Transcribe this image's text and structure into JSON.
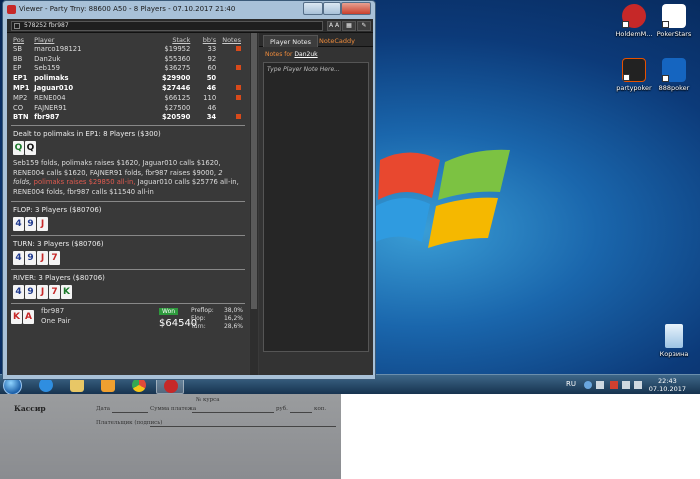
{
  "window": {
    "title": "Viewer - Party Trny: 88600 A50 - 8 Players - 07.10.2017 21:40",
    "hand_id": "578252 fbr987",
    "font_button": "A A"
  },
  "players": {
    "headers": {
      "pos": "Pos",
      "player": "Player",
      "stack": "Stack",
      "bbs": "bb's",
      "notes": "Notes"
    },
    "rows": [
      {
        "pos": "SB",
        "player": "marco198121",
        "stack": "$19952",
        "bbs": "33",
        "note": true,
        "hero": false
      },
      {
        "pos": "BB",
        "player": "Dan2uk",
        "stack": "$55360",
        "bbs": "92",
        "note": false,
        "hero": false
      },
      {
        "pos": "EP",
        "player": "Seb159",
        "stack": "$36275",
        "bbs": "60",
        "note": true,
        "hero": false
      },
      {
        "pos": "EP1",
        "player": "polimaks",
        "stack": "$29900",
        "bbs": "50",
        "note": false,
        "hero": true
      },
      {
        "pos": "MP1",
        "player": "Jaguar010",
        "stack": "$27446",
        "bbs": "46",
        "note": true,
        "hero": true
      },
      {
        "pos": "MP2",
        "player": "RENE004",
        "stack": "$66125",
        "bbs": "110",
        "note": true,
        "hero": false
      },
      {
        "pos": "CO",
        "player": "FAJNER91",
        "stack": "$27500",
        "bbs": "46",
        "note": false,
        "hero": false
      },
      {
        "pos": "BTN",
        "player": "fbr987",
        "stack": "$20590",
        "bbs": "34",
        "note": true,
        "hero": true
      }
    ]
  },
  "preflop": {
    "title": "Dealt to polimaks in EP1: 8 Players ($300)",
    "cards": [
      {
        "rank": "Q",
        "color": "#1b7a2b"
      },
      {
        "rank": "Q",
        "color": "#111111"
      }
    ],
    "a1": "Seb159 folds, polimaks raises $1620, Jaguar010 calls $1620, RENE004 calls $1620, FAJNER91 folds, fbr987 raises $9000,",
    "a2": "2 folds,",
    "a3": "polimaks raises $29850 all-in,",
    "a4": "Jaguar010 calls $25776 all-in, RENE004 folds, fbr987 calls $11540 all-in"
  },
  "flop": {
    "title": "FLOP: 3 Players ($80706)",
    "cards": [
      {
        "rank": "4",
        "color": "#1f3a8f"
      },
      {
        "rank": "9",
        "color": "#1f3a8f"
      },
      {
        "rank": "J",
        "color": "#c62828"
      }
    ]
  },
  "turn": {
    "title": "TURN: 3 Players ($80706)",
    "cards": [
      {
        "rank": "4",
        "color": "#1f3a8f"
      },
      {
        "rank": "9",
        "color": "#1f3a8f"
      },
      {
        "rank": "J",
        "color": "#c62828"
      },
      {
        "rank": "7",
        "color": "#c62828"
      }
    ]
  },
  "river": {
    "title": "RIVER: 3 Players ($80706)",
    "cards": [
      {
        "rank": "4",
        "color": "#1f3a8f"
      },
      {
        "rank": "9",
        "color": "#1f3a8f"
      },
      {
        "rank": "J",
        "color": "#c62828"
      },
      {
        "rank": "7",
        "color": "#c62828"
      },
      {
        "rank": "K",
        "color": "#1b7a2b"
      }
    ]
  },
  "result": {
    "cards": [
      {
        "rank": "K",
        "color": "#c62828"
      },
      {
        "rank": "A",
        "color": "#c62828"
      }
    ],
    "player": "fbr987",
    "hand": "One Pair",
    "won_label": "Won",
    "amount": "$64540",
    "equity": [
      {
        "label": "Preflop:",
        "value": "38,0%"
      },
      {
        "label": "Flop:",
        "value": "16,2%"
      },
      {
        "label": "Turn:",
        "value": "28,6%"
      }
    ]
  },
  "notes_panel": {
    "tab_player_notes": "Player Notes",
    "tab_notecaddy": "NoteCaddy",
    "notes_for_label": "Notes for",
    "notes_for_player": "Dan2uk",
    "placeholder": "Type Player Note Here..."
  },
  "desktop": {
    "icons": [
      {
        "label": "HoldemM...",
        "color": "#c62828"
      },
      {
        "label": "PokerStars",
        "color": "#b71c1c"
      },
      {
        "label": "partypoker",
        "color": "#222222"
      },
      {
        "label": "888poker",
        "color": "#1565c0"
      },
      {
        "label": "Корзина",
        "color": "#cfe3f5"
      }
    ]
  },
  "taskbar": {
    "apps": [
      {
        "name": "ie-icon",
        "color": "#2f8ee0"
      },
      {
        "name": "folder-icon",
        "color": "#e8c766"
      },
      {
        "name": "media-player-icon",
        "color": "#f0a030"
      },
      {
        "name": "chrome-icon",
        "color": "#e04a3a"
      },
      {
        "name": "holdem-manager-icon",
        "color": "#c62828"
      }
    ],
    "lang": "RU",
    "time": "22:43",
    "date": "07.10.2017"
  },
  "paper": {
    "kassir": "Кассир",
    "f1": "№ курса",
    "f2": "Дата",
    "f3": "Сумма платежа",
    "f4": "руб.",
    "f5": "коп.",
    "f6": "Плательщик (подпись)"
  }
}
